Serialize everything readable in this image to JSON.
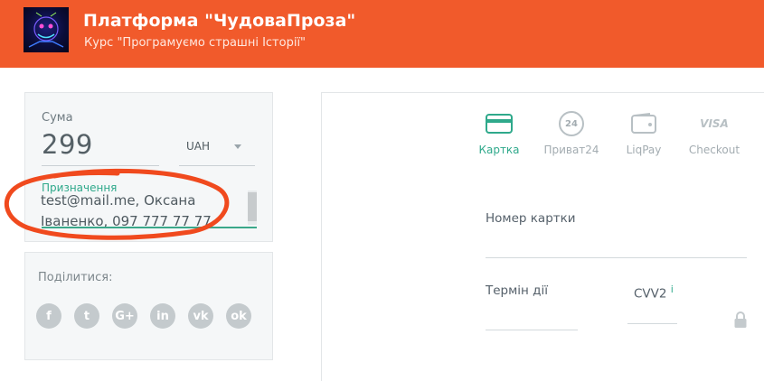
{
  "header": {
    "title": "Платформа \"ЧудоваПроза\"",
    "subtitle": "Курс \"Програмуємо страшні Історії\""
  },
  "payment": {
    "amount_label": "Сума",
    "amount_value": "299",
    "currency": "UAH",
    "purpose_label": "Призначення",
    "purpose_value": "test@mail.me, Оксана\nІваненко, 097 777 77 77"
  },
  "share": {
    "label": "Поділитися:",
    "icons": [
      {
        "name": "facebook-icon",
        "glyph": "f"
      },
      {
        "name": "twitter-icon",
        "glyph": "t"
      },
      {
        "name": "google-plus-icon",
        "glyph": "G+"
      },
      {
        "name": "linkedin-icon",
        "glyph": "in"
      },
      {
        "name": "vk-icon",
        "glyph": "vk"
      },
      {
        "name": "odnoklassniki-icon",
        "glyph": "ok"
      }
    ]
  },
  "methods": [
    {
      "label": "Картка",
      "icon": "card-icon",
      "active": true
    },
    {
      "label": "Приват24",
      "icon": "privat24-icon",
      "badge": "24"
    },
    {
      "label": "LiqPay",
      "icon": "wallet-icon"
    },
    {
      "label": "Checkout",
      "icon": "visa-icon",
      "badge": "VISA"
    }
  ],
  "card": {
    "number_label": "Номер картки",
    "expiry_label": "Термін дії",
    "cvv_label": "CVV2",
    "cvv_info": "i"
  },
  "colors": {
    "header": "#f15a2b",
    "accent": "#2fa98b",
    "annotation": "#f04a1e"
  }
}
